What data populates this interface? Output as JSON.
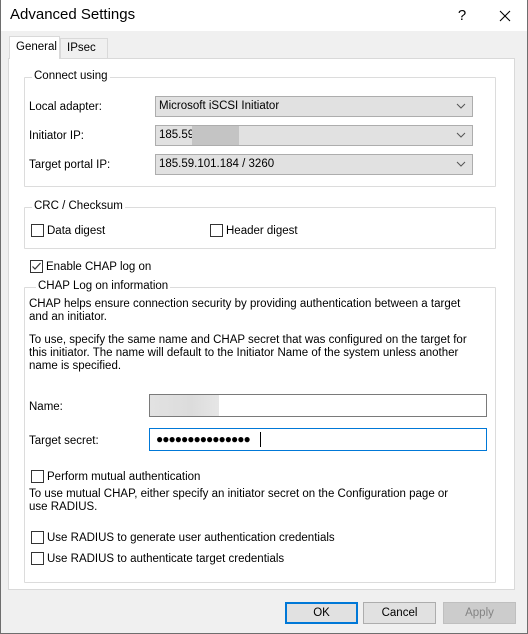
{
  "window": {
    "title": "Advanced Settings",
    "help_label": "?",
    "close_icon": "close-icon"
  },
  "tabs": [
    {
      "label": "General",
      "active": true
    },
    {
      "label": "IPsec",
      "active": false
    }
  ],
  "connect_using": {
    "group_label": "Connect using",
    "local_adapter": {
      "label": "Local adapter:",
      "value": "Microsoft iSCSI Initiator"
    },
    "initiator_ip": {
      "label": "Initiator IP:",
      "value": "185.59",
      "redacted": true
    },
    "target_portal_ip": {
      "label": "Target portal IP:",
      "value": "185.59.101.184 / 3260"
    }
  },
  "crc_checksum": {
    "group_label": "CRC / Checksum",
    "data_digest": {
      "label": "Data digest",
      "checked": false
    },
    "header_digest": {
      "label": "Header digest",
      "checked": false
    }
  },
  "enable_chap": {
    "label": "Enable CHAP log on",
    "checked": true
  },
  "chap_info": {
    "group_label": "CHAP Log on information",
    "description_1": "CHAP helps ensure connection security by providing authentication between a target and an initiator.",
    "description_2": "To use, specify the same name and CHAP secret that was configured on the target for this initiator.  The name will default to the Initiator Name of the system unless another name is specified.",
    "name": {
      "label": "Name:",
      "value": "",
      "redacted": true
    },
    "target_secret": {
      "label": "Target secret:",
      "value": "●●●●●●●●●●●●●●●",
      "masked_length": 15
    },
    "mutual_auth": {
      "label": "Perform mutual authentication",
      "checked": false
    },
    "mutual_note": "To use mutual CHAP, either specify an initiator secret on the Configuration page or use RADIUS.",
    "radius_generate": {
      "label": "Use RADIUS to generate user authentication credentials",
      "checked": false
    },
    "radius_authenticate": {
      "label": "Use RADIUS to authenticate target credentials",
      "checked": false
    }
  },
  "buttons": {
    "ok": "OK",
    "cancel": "Cancel",
    "apply": "Apply"
  },
  "colors": {
    "accent": "#0078d7",
    "window_bg": "#f0f0f0",
    "button_bg": "#e1e1e1"
  }
}
